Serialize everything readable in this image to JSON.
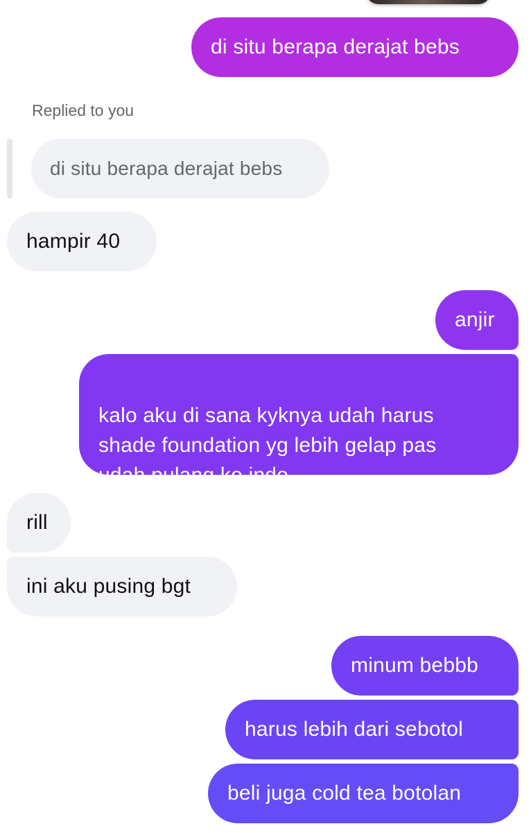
{
  "colors": {
    "outgoing_gradient_top": "#b52ee0",
    "outgoing_mid": "#8b39f2",
    "outgoing_bottom": "#6b4cf6",
    "incoming_bg": "#f0f2f5",
    "meta_text": "#65676b"
  },
  "messages": [
    {
      "id": "m1",
      "side": "outgoing",
      "text": "di situ berapa derajat bebs"
    },
    {
      "id": "m2",
      "side": "meta",
      "text": "Replied to you"
    },
    {
      "id": "m3",
      "side": "quoted",
      "text": "di situ berapa derajat bebs"
    },
    {
      "id": "m4",
      "side": "incoming",
      "text": "hampir 40"
    },
    {
      "id": "m5",
      "side": "outgoing",
      "text": "anjir"
    },
    {
      "id": "m6",
      "side": "outgoing",
      "text": "kalo aku di sana kyknya udah harus\nshade foundation yg lebih gelap pas\nudah pulang ke indo"
    },
    {
      "id": "m7",
      "side": "incoming",
      "text": "rill"
    },
    {
      "id": "m8",
      "side": "incoming",
      "text": "ini aku pusing bgt"
    },
    {
      "id": "m9",
      "side": "outgoing",
      "text": "minum bebbb"
    },
    {
      "id": "m10",
      "side": "outgoing",
      "text": "harus lebih dari sebotol"
    },
    {
      "id": "m11",
      "side": "outgoing",
      "text": "beli juga cold tea botolan"
    }
  ]
}
